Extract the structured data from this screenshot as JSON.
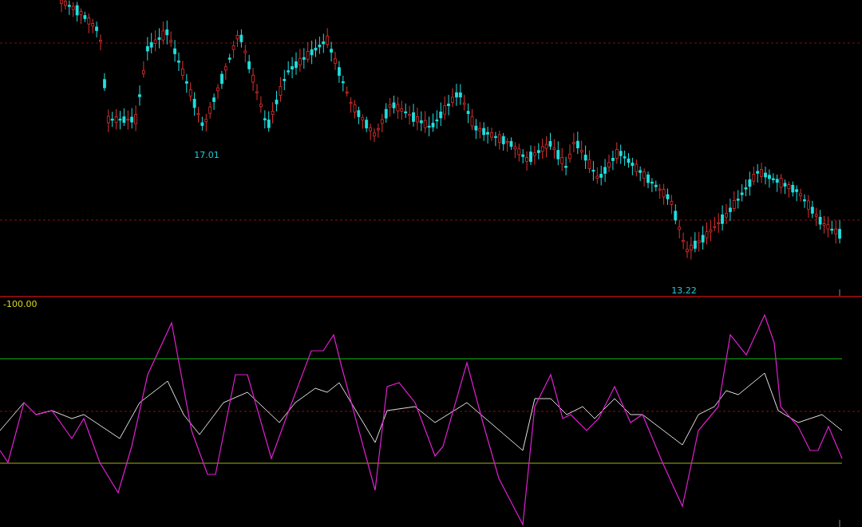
{
  "price_chart": {
    "low_labels": [
      "17.01",
      "13.22"
    ]
  },
  "indicator_chart": {
    "scale_label": "-100.00"
  }
}
